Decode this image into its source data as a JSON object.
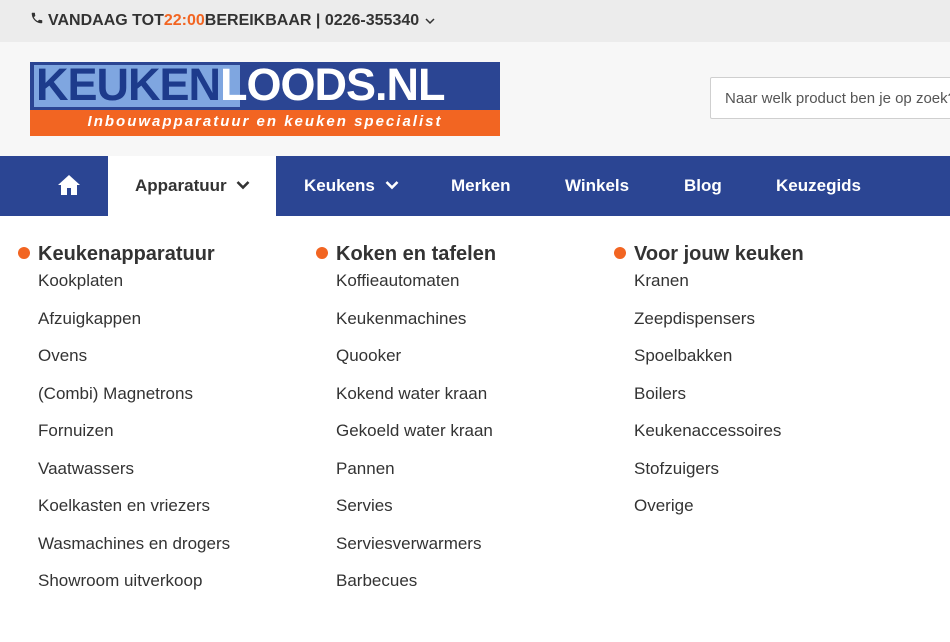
{
  "topbar": {
    "prefix": "VANDAAG TOT ",
    "time": "22:00",
    "suffix": " BEREIKBAAR | 0226-355340"
  },
  "logo": {
    "part1": "KEUKEN",
    "part2": "LOODS.NL",
    "tagline": "Inbouwapparatuur en keuken specialist"
  },
  "search": {
    "placeholder": "Naar welk product ben je op zoek?"
  },
  "nav": {
    "items": [
      {
        "label": "Apparatuur"
      },
      {
        "label": "Keukens"
      },
      {
        "label": "Merken"
      },
      {
        "label": "Winkels"
      },
      {
        "label": "Blog"
      },
      {
        "label": "Keuzegids"
      }
    ]
  },
  "menu": {
    "columns": [
      {
        "heading": "Keukenapparatuur",
        "links": [
          "Kookplaten",
          "Afzuigkappen",
          "Ovens",
          "(Combi) Magnetrons",
          "Fornuizen",
          "Vaatwassers",
          "Koelkasten en vriezers",
          "Wasmachines en drogers",
          "Showroom uitverkoop"
        ]
      },
      {
        "heading": "Koken en tafelen",
        "links": [
          "Koffieautomaten",
          "Keukenmachines",
          "Quooker",
          "Kokend water kraan",
          "Gekoeld water kraan",
          "Pannen",
          "Servies",
          "Serviesverwarmers",
          "Barbecues"
        ]
      },
      {
        "heading": "Voor jouw keuken",
        "links": [
          "Kranen",
          "Zeepdispensers",
          "Spoelbakken",
          "Boilers",
          "Keukenaccessoires",
          "Stofzuigers",
          "Overige"
        ]
      }
    ]
  },
  "colors": {
    "brand_blue": "#2b4593",
    "accent_orange": "#f26522",
    "topbar_bg": "#ececec"
  },
  "icons": {
    "phone": "phone-icon",
    "home": "home-icon",
    "chevron": "chevron-down-icon"
  }
}
